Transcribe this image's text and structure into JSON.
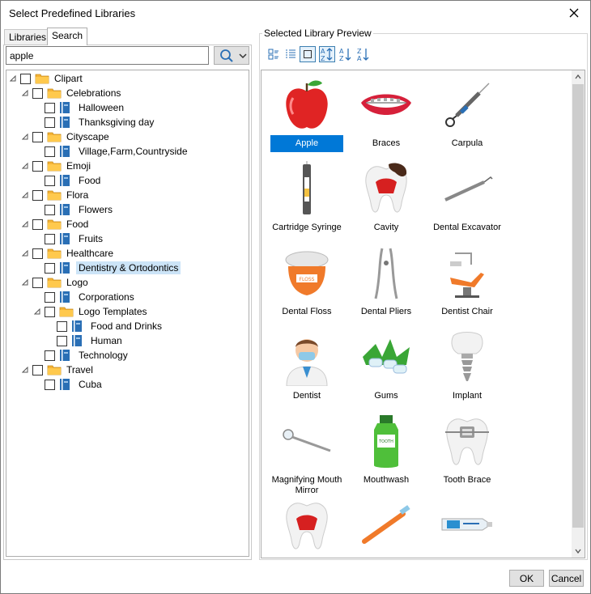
{
  "window": {
    "title": "Select Predefined Libraries"
  },
  "tabs": [
    {
      "label": "Libraries"
    },
    {
      "label": "Search"
    }
  ],
  "search": {
    "value": "apple",
    "placeholder": ""
  },
  "tree": [
    {
      "label": "Clipart",
      "type": "folder",
      "level": 0,
      "expanded": true
    },
    {
      "label": "Celebrations",
      "type": "folder",
      "level": 1,
      "expanded": true
    },
    {
      "label": "Halloween",
      "type": "book",
      "level": 2
    },
    {
      "label": "Thanksgiving day",
      "type": "book",
      "level": 2
    },
    {
      "label": "Cityscape",
      "type": "folder",
      "level": 1,
      "expanded": true
    },
    {
      "label": "Village,Farm,Countryside",
      "type": "book",
      "level": 2
    },
    {
      "label": "Emoji",
      "type": "folder",
      "level": 1,
      "expanded": true
    },
    {
      "label": "Food",
      "type": "book",
      "level": 2
    },
    {
      "label": "Flora",
      "type": "folder",
      "level": 1,
      "expanded": true
    },
    {
      "label": "Flowers",
      "type": "book",
      "level": 2
    },
    {
      "label": "Food",
      "type": "folder",
      "level": 1,
      "expanded": true
    },
    {
      "label": "Fruits",
      "type": "book",
      "level": 2
    },
    {
      "label": "Healthcare",
      "type": "folder",
      "level": 1,
      "expanded": true
    },
    {
      "label": "Dentistry & Ortodontics",
      "type": "book",
      "level": 2,
      "selected": true
    },
    {
      "label": "Logo",
      "type": "folder",
      "level": 1,
      "expanded": true
    },
    {
      "label": "Corporations",
      "type": "book",
      "level": 2
    },
    {
      "label": "Logo Templates",
      "type": "folder",
      "level": 2,
      "expanded": true
    },
    {
      "label": "Food and Drinks",
      "type": "book",
      "level": 3
    },
    {
      "label": "Human",
      "type": "book",
      "level": 3
    },
    {
      "label": "Technology",
      "type": "book",
      "level": 2
    },
    {
      "label": "Travel",
      "type": "folder",
      "level": 1,
      "expanded": true
    },
    {
      "label": "Cuba",
      "type": "book",
      "level": 2
    }
  ],
  "preview": {
    "title": "Selected Library Preview",
    "toolbar": [
      {
        "name": "large-icons-view-icon"
      },
      {
        "name": "list-view-icon"
      },
      {
        "name": "tile-view-icon",
        "active": true
      },
      {
        "name": "sort-mixed-icon"
      },
      {
        "name": "sort-ascending-icon"
      },
      {
        "name": "sort-descending-icon"
      }
    ],
    "items": [
      {
        "label": "Apple",
        "icon": "apple-icon",
        "selected": true
      },
      {
        "label": "Braces",
        "icon": "braces-icon"
      },
      {
        "label": "Carpula",
        "icon": "carpula-icon"
      },
      {
        "label": "Cartridge Syringe",
        "icon": "cartridge-syringe-icon"
      },
      {
        "label": "Cavity",
        "icon": "cavity-icon"
      },
      {
        "label": "Dental Excavator",
        "icon": "dental-excavator-icon"
      },
      {
        "label": "Dental Floss",
        "icon": "dental-floss-icon"
      },
      {
        "label": "Dental Pliers",
        "icon": "dental-pliers-icon"
      },
      {
        "label": "Dentist Chair",
        "icon": "dentist-chair-icon"
      },
      {
        "label": "Dentist",
        "icon": "dentist-icon"
      },
      {
        "label": "Gums",
        "icon": "gums-icon"
      },
      {
        "label": "Implant",
        "icon": "implant-icon"
      },
      {
        "label": "Magnifying Mouth Mirror",
        "icon": "mouth-mirror-icon"
      },
      {
        "label": "Mouthwash",
        "icon": "mouthwash-icon"
      },
      {
        "label": "Tooth Brace",
        "icon": "tooth-brace-icon"
      },
      {
        "label": "",
        "icon": "tooth-icon"
      },
      {
        "label": "",
        "icon": "toothbrush-icon"
      },
      {
        "label": "",
        "icon": "toothpaste-icon"
      }
    ]
  },
  "buttons": {
    "ok": "OK",
    "cancel": "Cancel"
  },
  "colors": {
    "selection": "#0078d7",
    "tree_selection": "#cce4f7",
    "folder": "#f5b335",
    "book": "#2a6fb5"
  }
}
